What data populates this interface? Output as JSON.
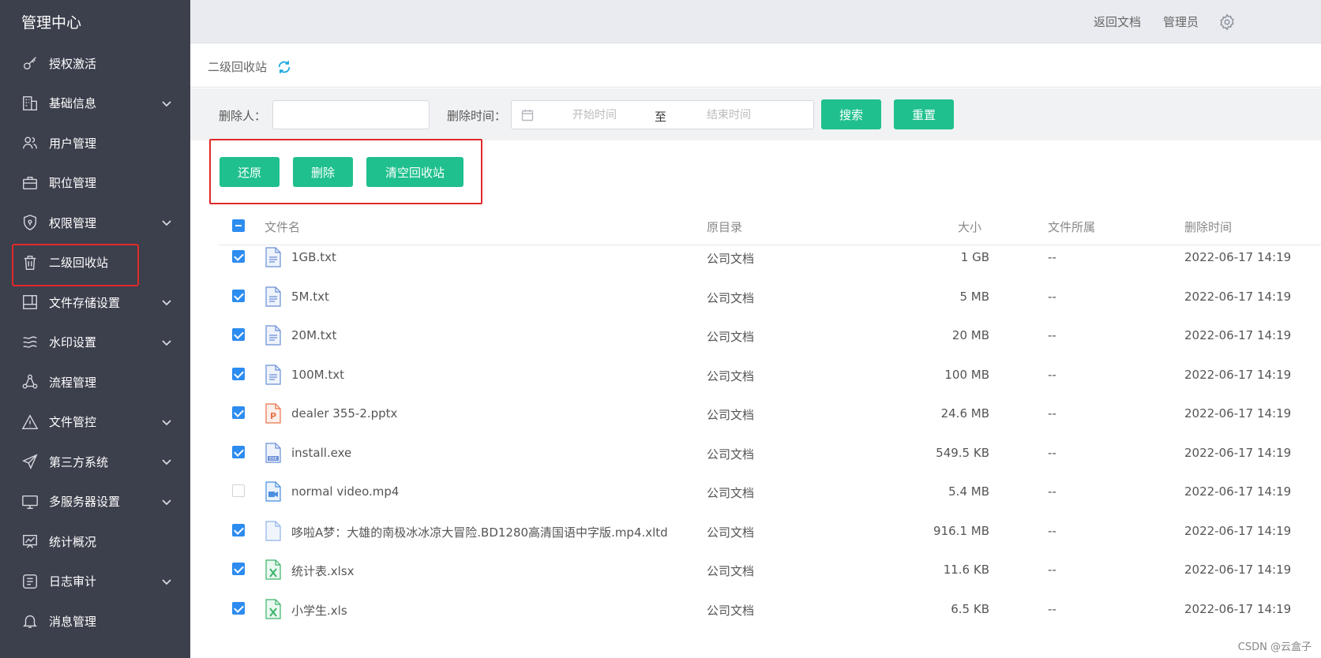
{
  "sidebar": {
    "brand": "管理中心",
    "items": [
      {
        "label": "授权激活",
        "icon": "key-icon",
        "has_children": false
      },
      {
        "label": "基础信息",
        "icon": "building-icon",
        "has_children": true
      },
      {
        "label": "用户管理",
        "icon": "users-icon",
        "has_children": false
      },
      {
        "label": "职位管理",
        "icon": "briefcase-icon",
        "has_children": false
      },
      {
        "label": "权限管理",
        "icon": "shield-icon",
        "has_children": true
      },
      {
        "label": "二级回收站",
        "icon": "trash-icon",
        "has_children": false,
        "active": true
      },
      {
        "label": "文件存储设置",
        "icon": "storage-icon",
        "has_children": true
      },
      {
        "label": "水印设置",
        "icon": "waves-icon",
        "has_children": true
      },
      {
        "label": "流程管理",
        "icon": "flow-icon",
        "has_children": false
      },
      {
        "label": "文件管控",
        "icon": "warning-icon",
        "has_children": true
      },
      {
        "label": "第三方系统",
        "icon": "send-icon",
        "has_children": true
      },
      {
        "label": "多服务器设置",
        "icon": "monitor-icon",
        "has_children": true
      },
      {
        "label": "统计概况",
        "icon": "chart-icon",
        "has_children": false
      },
      {
        "label": "日志审计",
        "icon": "log-icon",
        "has_children": true
      },
      {
        "label": "消息管理",
        "icon": "bell-icon",
        "has_children": false
      }
    ]
  },
  "topbar": {
    "back_link": "返回文档",
    "user": "管理员"
  },
  "page": {
    "title": "二级回收站"
  },
  "filter": {
    "deleter_label": "删除人：",
    "deleter_value": "",
    "time_label": "删除时间：",
    "start_placeholder": "开始时间",
    "range_sep": "至",
    "end_placeholder": "结束时间",
    "search_button": "搜索",
    "reset_button": "重置"
  },
  "actions": {
    "restore": "还原",
    "delete": "删除",
    "empty": "清空回收站"
  },
  "table": {
    "headers": {
      "name": "文件名",
      "dir": "原目录",
      "size": "大小",
      "owner": "文件所属",
      "time": "删除时间"
    },
    "rows": [
      {
        "checked": true,
        "type": "txt",
        "name": "1GB.txt",
        "dir": "公司文档",
        "size": "1 GB",
        "owner": "--",
        "time": "2022-06-17 14:19"
      },
      {
        "checked": true,
        "type": "txt",
        "name": "5M.txt",
        "dir": "公司文档",
        "size": "5 MB",
        "owner": "--",
        "time": "2022-06-17 14:19"
      },
      {
        "checked": true,
        "type": "txt",
        "name": "20M.txt",
        "dir": "公司文档",
        "size": "20 MB",
        "owner": "--",
        "time": "2022-06-17 14:19"
      },
      {
        "checked": true,
        "type": "txt",
        "name": "100M.txt",
        "dir": "公司文档",
        "size": "100 MB",
        "owner": "--",
        "time": "2022-06-17 14:19"
      },
      {
        "checked": true,
        "type": "pptx",
        "name": "dealer 355-2.pptx",
        "dir": "公司文档",
        "size": "24.6 MB",
        "owner": "--",
        "time": "2022-06-17 14:19"
      },
      {
        "checked": true,
        "type": "exe",
        "name": "install.exe",
        "dir": "公司文档",
        "size": "549.5 KB",
        "owner": "--",
        "time": "2022-06-17 14:19"
      },
      {
        "checked": false,
        "type": "video",
        "name": "normal video.mp4",
        "dir": "公司文档",
        "size": "5.4 MB",
        "owner": "--",
        "time": "2022-06-17 14:19"
      },
      {
        "checked": true,
        "type": "blank",
        "name": "哆啦A梦：大雄的南极冰冰凉大冒险.BD1280高清国语中字版.mp4.xltd",
        "dir": "公司文档",
        "size": "916.1 MB",
        "owner": "--",
        "time": "2022-06-17 14:19"
      },
      {
        "checked": true,
        "type": "xlsx",
        "name": "统计表.xlsx",
        "dir": "公司文档",
        "size": "11.6 KB",
        "owner": "--",
        "time": "2022-06-17 14:19"
      },
      {
        "checked": true,
        "type": "xlsx",
        "name": "小学生.xls",
        "dir": "公司文档",
        "size": "6.5 KB",
        "owner": "--",
        "time": "2022-06-17 14:19"
      }
    ]
  },
  "watermark": "CSDN @云盒子",
  "colors": {
    "sidebar_bg": "#3c3f4c",
    "accent": "#1fc08e",
    "checkbox": "#2d8cf0",
    "highlight_border": "#e02a2a"
  }
}
